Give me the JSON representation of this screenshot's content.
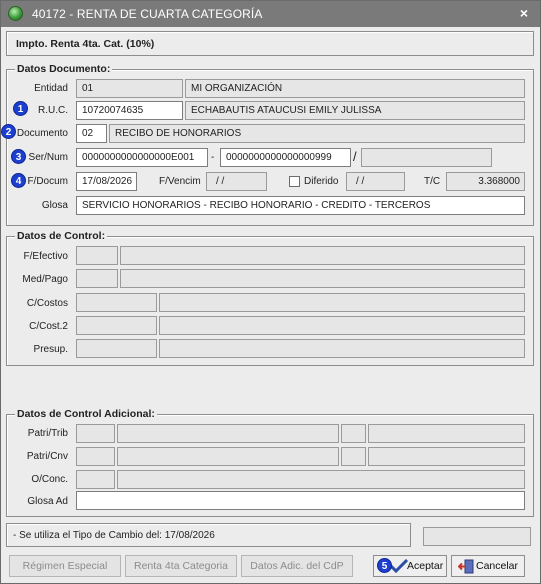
{
  "window": {
    "title": "40172 - RENTA DE CUARTA CATEGORÍA",
    "close_glyph": "×"
  },
  "header": {
    "text": "Impto. Renta 4ta. Cat. (10%)"
  },
  "datos_documento": {
    "title": "Datos Documento:",
    "entidad": {
      "label": "Entidad",
      "code": "01",
      "name": "MI ORGANIZACIÓN"
    },
    "ruc": {
      "label": "R.U.C.",
      "value": "10720074635",
      "name": "ECHABAUTIS ATAUCUSI EMILY JULISSA"
    },
    "documento": {
      "label": "Documento",
      "code": "02",
      "name": "RECIBO DE HONORARIOS"
    },
    "ser_num": {
      "label": "Ser/Num",
      "serie": "0000000000000000E001",
      "dash": "-",
      "numero": "0000000000000000999",
      "slash": "/",
      "extra": ""
    },
    "f_docum": {
      "label": "F/Docum",
      "value": "17/08/2026"
    },
    "f_vencim": {
      "label": "F/Vencim",
      "value": "/ /"
    },
    "diferido": {
      "label": "Diferido",
      "value": "/ /",
      "checked": false
    },
    "tc": {
      "label": "T/C",
      "value": "3.368000"
    },
    "glosa": {
      "label": "Glosa",
      "value": "SERVICIO HONORARIOS - RECIBO HONORARIO - CREDITO - TERCEROS"
    },
    "badges": [
      "1",
      "2",
      "3",
      "4"
    ]
  },
  "datos_control": {
    "title": "Datos de Control:",
    "f_efectivo": "F/Efectivo",
    "med_pago": "Med/Pago",
    "c_costos": "C/Costos",
    "c_cost2": "C/Cost.2",
    "presup": "Presup."
  },
  "datos_control_adicional": {
    "title": "Datos de Control Adicional:",
    "patri_trib": "Patri/Trib",
    "patri_cnv": "Patri/Cnv",
    "o_conc": "O/Conc.",
    "glosa_ad": "Glosa Ad"
  },
  "status": {
    "text": "- Se utiliza el Tipo de Cambio del: 17/08/2026"
  },
  "buttons": {
    "regimen": "Régimen Especial",
    "renta4ta": "Renta 4ta Categoria",
    "datos_adic": "Datos Adic. del CdP",
    "aceptar": "Aceptar",
    "cancelar": "Cancelar",
    "badge5": "5"
  }
}
